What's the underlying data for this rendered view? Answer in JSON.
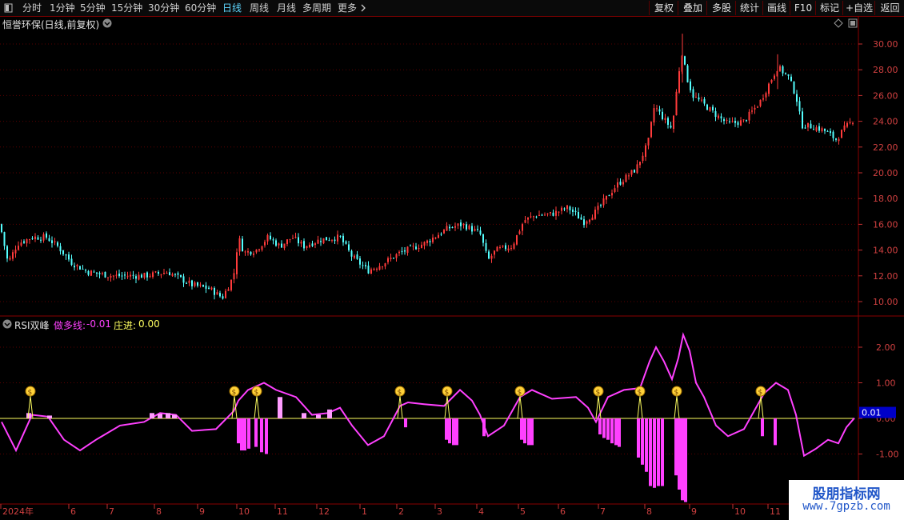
{
  "toolbar": {
    "window_icon": "window-icon",
    "periods": [
      {
        "label": "分时",
        "active": false
      },
      {
        "label": "1分钟",
        "active": false
      },
      {
        "label": "5分钟",
        "active": false
      },
      {
        "label": "15分钟",
        "active": false
      },
      {
        "label": "30分钟",
        "active": false
      },
      {
        "label": "60分钟",
        "active": false
      },
      {
        "label": "日线",
        "active": true
      },
      {
        "label": "周线",
        "active": false
      },
      {
        "label": "月线",
        "active": false
      },
      {
        "label": "多周期",
        "active": false
      },
      {
        "label": "更多",
        "active": false
      }
    ],
    "more_icon": "chevron-right-icon",
    "right_buttons": [
      "复权",
      "叠加",
      "多股",
      "统计",
      "画线",
      "F10",
      "标记",
      "+自选",
      "返回"
    ]
  },
  "main_chart": {
    "title": "恒誉环保(日线,前复权)",
    "title_dropdown_icon": "chevron-down-icon",
    "corner_icons": [
      "diamond-icon",
      "settings-icon"
    ],
    "y_ticks": [
      "30.00",
      "28.00",
      "26.00",
      "24.00",
      "22.00",
      "20.00",
      "18.00",
      "16.00",
      "14.00",
      "12.00",
      "10.00"
    ],
    "y_values": [
      30,
      28,
      26,
      24,
      22,
      20,
      18,
      16,
      14,
      12,
      10
    ],
    "up_color": "#ff3b3b",
    "down_color": "#54ffff"
  },
  "indicator": {
    "name": "RSI双峰",
    "dropdown_icon": "chevron-down-icon",
    "line1_label": "做多线:",
    "line1_value": "-0.01",
    "line2_label": "庄进:",
    "line2_value": "0.00",
    "y_ticks": [
      "2.00",
      "1.00",
      "0.00",
      "-1.00"
    ],
    "y_values": [
      2,
      1,
      0,
      -1
    ],
    "current_value": "0.01",
    "line_color": "#ff40ff",
    "signal_color": "#ffff60",
    "marker_icon": "money-bag-icon"
  },
  "x_axis": {
    "labels": [
      "2024年",
      "6",
      "7",
      "8",
      "9",
      "10",
      "11",
      "12",
      "1",
      "2",
      "3",
      "4",
      "5",
      "6",
      "7",
      "8",
      "9",
      "10",
      "11"
    ]
  },
  "watermark": {
    "line1": "股朋指标网",
    "line2": "www.7gpzb.com"
  }
}
